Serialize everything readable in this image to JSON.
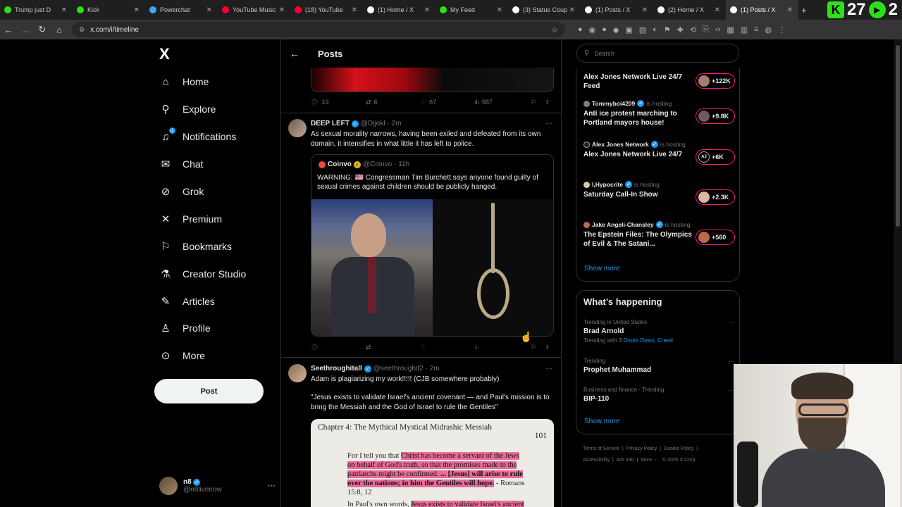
{
  "browser": {
    "tabs": [
      {
        "label": "Trump just D",
        "color": "#2ee01a"
      },
      {
        "label": "Kick",
        "color": "#2ee01a"
      },
      {
        "label": "Powerchat",
        "color": "#3da9f5"
      },
      {
        "label": "YouTube Music",
        "color": "#ff0033"
      },
      {
        "label": "(18) YouTube",
        "color": "#ff0033"
      },
      {
        "label": "(1) Home / X",
        "color": "#ffffff"
      },
      {
        "label": "My Feed",
        "color": "#2ee01a"
      },
      {
        "label": "(3) Status Coup",
        "color": "#ffffff"
      },
      {
        "label": "(1) Posts / X",
        "color": "#ffffff"
      },
      {
        "label": "(2) Home / X",
        "color": "#ffffff"
      },
      {
        "label": "(1) Posts / X",
        "color": "#ffffff",
        "active": true
      }
    ],
    "ext_counter": "27",
    "ext_counter2": "2",
    "url": "x.com/i/timeline"
  },
  "nav": {
    "logo": "X",
    "items": [
      {
        "label": "Home",
        "icon": "home-icon"
      },
      {
        "label": "Explore",
        "icon": "search-icon"
      },
      {
        "label": "Notifications",
        "icon": "bell-icon",
        "badge": "1"
      },
      {
        "label": "Chat",
        "icon": "mail-icon"
      },
      {
        "label": "Grok",
        "icon": "grok-icon"
      },
      {
        "label": "Premium",
        "icon": "x-premium-icon"
      },
      {
        "label": "Bookmarks",
        "icon": "bookmark-icon"
      },
      {
        "label": "Creator Studio",
        "icon": "flask-icon"
      },
      {
        "label": "Articles",
        "icon": "article-icon"
      },
      {
        "label": "Profile",
        "icon": "person-icon"
      },
      {
        "label": "More",
        "icon": "more-circle-icon"
      }
    ],
    "post_button": "Post",
    "account": {
      "name": "n8",
      "handle": "@n8livenow"
    }
  },
  "timeline": {
    "title": "Posts",
    "top_post_actions": {
      "replies": "19",
      "reposts": "6",
      "likes": "67",
      "views": "687"
    },
    "tweet1": {
      "name": "DEEP LEFT",
      "handle": "@Dijokl",
      "time": "· 2m",
      "text": "As sexual morality narrows, having been exiled and defeated from its own domain, it intensifies in what little it has left to police.",
      "quote": {
        "name": "Coinvo",
        "handle": "@Coinvo",
        "time": "· 11h",
        "text": "WARNING: 🇺🇸 Congressman Tim Burchett says anyone found guilty of sexual crimes against children should be publicly hanged."
      }
    },
    "tweet2": {
      "name": "Seethroughitall",
      "handle": "@seethroughit2",
      "time": "· 2m",
      "text1": "Adam is plagiarizing my work!!!!! (CJB somewhere probably)",
      "text2": "\"Jesus exists to validate Israel's ancient covenant — and Paul's mission is to bring the Messiah and the God of Israel to rule the Gentiles\"",
      "doc_title": "Chapter 4: The Mythical Mystical Midrashic Messiah",
      "doc_page": "101",
      "doc_line1a": "For I tell you that ",
      "doc_line1b": "Christ has become a servant of the Jews",
      "doc_line2": "on behalf of God's truth, so that the promises made to the",
      "doc_line3a": "patriarchs might be confirmed. ",
      "doc_line3b": "... [Jesus] will arise to rule",
      "doc_line4a": "over the nations; in him the Gentiles will hope.",
      "doc_line4b": " - Romans",
      "doc_line5": "15:8, 12",
      "doc_line6a": "In Paul's own words, ",
      "doc_line6b": "Jesus exists to validate Israel's ancient"
    }
  },
  "right": {
    "search_placeholder": "Search",
    "live": [
      {
        "host": "",
        "hosting": "",
        "title": "Alex Jones Network Live 24/7 Feed",
        "count": "+122K"
      },
      {
        "host": "Tommyboi4209",
        "hosting": "is hosting",
        "title": "Anti ice protest marching to Portland mayors house!",
        "count": "+9.8K"
      },
      {
        "host": "Alex Jones Network",
        "hosting": "is hosting",
        "title": "Alex Jones Network Live 24/7",
        "count": "+6K"
      },
      {
        "host": "I,Hypocrite",
        "hosting": "is hosting",
        "title": "Saturday Call-In Show",
        "count": "+2.3K"
      },
      {
        "host": "Jake Angeli-Chansley",
        "hosting": "is hosting",
        "title": "The Epstein Files: The Olympics of Evil & The Satani...",
        "count": "+560"
      }
    ],
    "live_show_more": "Show more",
    "happening_title": "What’s happening",
    "trends": [
      {
        "meta": "Trending in United States",
        "name": "Brad Arnold",
        "with_prefix": "Trending with ",
        "with_links": "3 Doors Down, Creed"
      },
      {
        "meta": "Trending",
        "name": "Prophet Muhammad"
      },
      {
        "meta": "Business and finance · Trending",
        "name": "BIP-110"
      }
    ],
    "happening_show_more": "Show more",
    "footer": {
      "terms": "Terms of Service",
      "privacy": "Privacy Policy",
      "cookie": "Cookie Policy",
      "accessibility": "Accessibility",
      "ads": "Ads info",
      "more": "More ···",
      "copyright": "© 2026 X Corp."
    }
  }
}
